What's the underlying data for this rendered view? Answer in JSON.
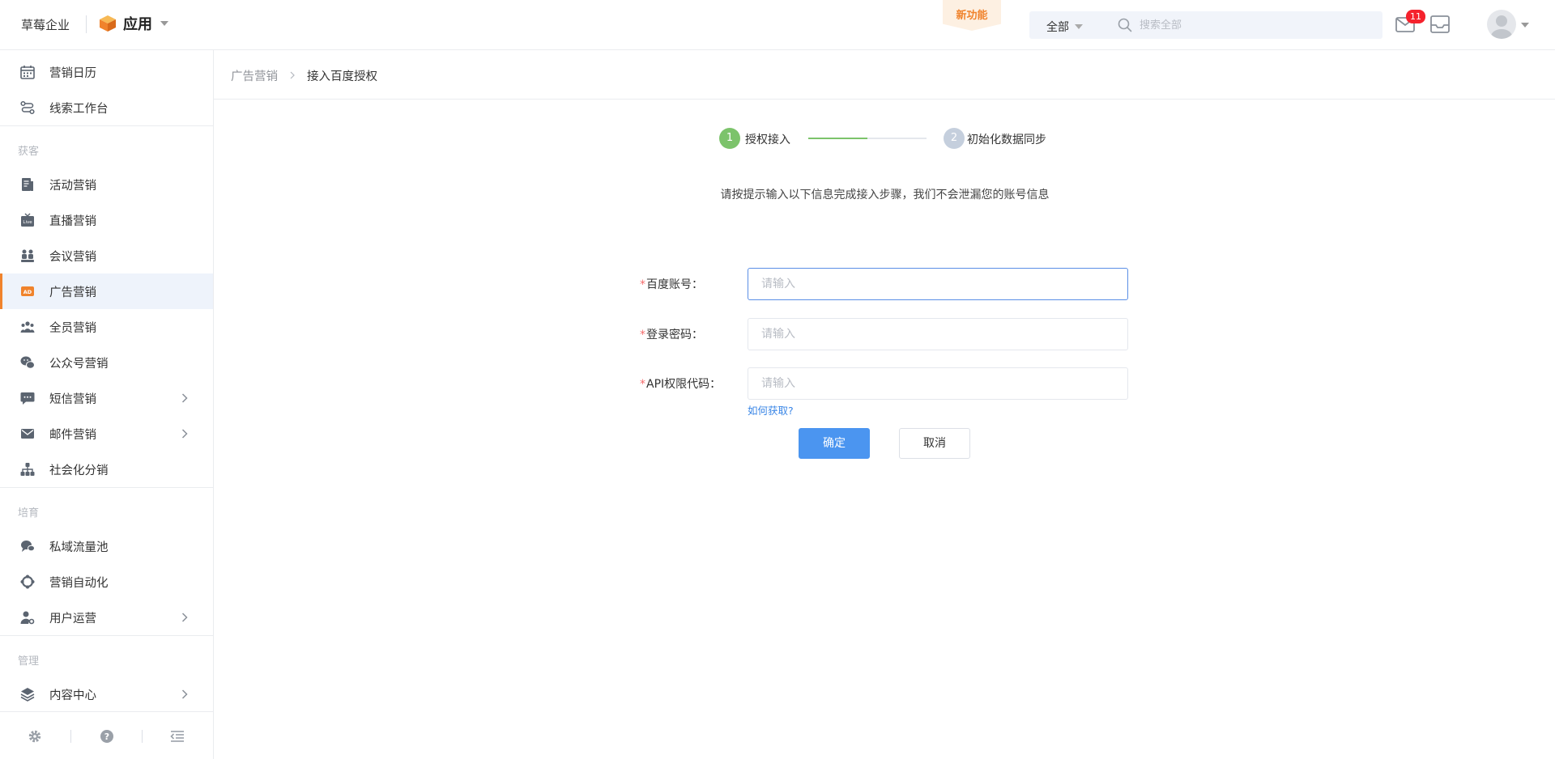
{
  "header": {
    "brand": "草莓企业",
    "app_label": "应用",
    "new_feature": "新功能",
    "search": {
      "scope": "全部",
      "placeholder": "搜索全部"
    },
    "mail_badge": "11"
  },
  "sidebar": {
    "top_items": [
      {
        "label": "营销日历",
        "icon": "calendar-icon"
      },
      {
        "label": "线索工作台",
        "icon": "route-icon"
      }
    ],
    "sections": [
      {
        "title": "获客",
        "items": [
          {
            "label": "活动营销",
            "icon": "document-icon"
          },
          {
            "label": "直播营销",
            "icon": "live-tv-icon"
          },
          {
            "label": "会议营销",
            "icon": "meeting-icon"
          },
          {
            "label": "广告营销",
            "icon": "ad-icon",
            "active": true
          },
          {
            "label": "全员营销",
            "icon": "team-icon"
          },
          {
            "label": "公众号营销",
            "icon": "wechat-icon"
          },
          {
            "label": "短信营销",
            "icon": "sms-icon",
            "expandable": true
          },
          {
            "label": "邮件营销",
            "icon": "mail-icon",
            "expandable": true
          },
          {
            "label": "社会化分销",
            "icon": "hierarchy-icon"
          }
        ]
      },
      {
        "title": "培育",
        "items": [
          {
            "label": "私域流量池",
            "icon": "chat-bubbles-icon"
          },
          {
            "label": "营销自动化",
            "icon": "automation-icon"
          },
          {
            "label": "用户运营",
            "icon": "user-settings-icon",
            "expandable": true
          }
        ]
      },
      {
        "title": "管理",
        "items": [
          {
            "label": "内容中心",
            "icon": "layers-icon",
            "expandable": true
          }
        ]
      }
    ],
    "footer_icons": [
      "gear-icon",
      "help-icon",
      "collapse-menu-icon"
    ]
  },
  "breadcrumb": {
    "parent": "广告营销",
    "current": "接入百度授权"
  },
  "steps": [
    {
      "number": "1",
      "label": "授权接入",
      "status": "done"
    },
    {
      "number": "2",
      "label": "初始化数据同步",
      "status": "todo"
    }
  ],
  "step_progress": 0.5,
  "hint": "请按提示输入以下信息完成接入步骤，我们不会泄漏您的账号信息",
  "form": {
    "account": {
      "label": "百度账号：",
      "value": "",
      "placeholder": "请输入"
    },
    "password": {
      "label": "登录密码：",
      "value": "",
      "placeholder": "请输入"
    },
    "api_code": {
      "label": "API权限代码：",
      "value": "",
      "placeholder": "请输入"
    },
    "help_link": "如何获取?",
    "required_mark": "*",
    "confirm_label": "确定",
    "cancel_label": "取消"
  },
  "colors": {
    "accent_orange": "#f0832c",
    "primary_blue": "#4b95f0",
    "step_green": "#7cc36b",
    "badge_red": "#f5222d"
  }
}
